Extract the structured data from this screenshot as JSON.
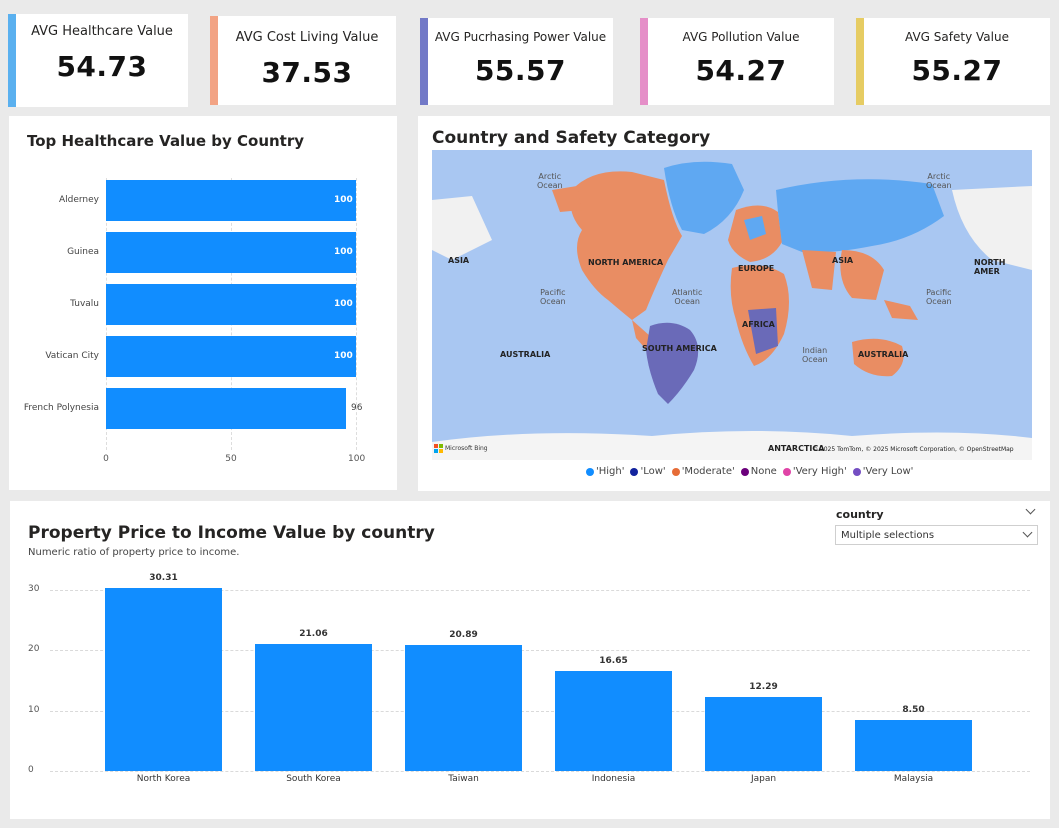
{
  "kpis": [
    {
      "label": "AVG Healthcare Value",
      "value": "54.73",
      "color": "#5ab0ef"
    },
    {
      "label": "AVG Cost Living Value",
      "value": "37.53",
      "color": "#f2a384"
    },
    {
      "label": "AVG Pucrhasing Power Value",
      "value": "55.57",
      "color": "#7279c7"
    },
    {
      "label": "AVG Pollution Value",
      "value": "54.27",
      "color": "#e58fc8"
    },
    {
      "label": "AVG Safety Value",
      "value": "55.27",
      "color": "#e6cc63"
    }
  ],
  "healthcare_chart": {
    "title": "Top Healthcare Value by Country",
    "chart_data": {
      "type": "bar",
      "orientation": "horizontal",
      "categories": [
        "Alderney",
        "Guinea",
        "Tuvalu",
        "Vatican City",
        "French Polynesia"
      ],
      "values": [
        100,
        100,
        100,
        100,
        96
      ],
      "value_labels": [
        "100",
        "100",
        "100",
        "100",
        "96"
      ],
      "xlim": [
        0,
        100
      ],
      "ticks": [
        "0",
        "50",
        "100"
      ],
      "color": "#118dff"
    }
  },
  "map": {
    "title": "Country and Safety Category",
    "oceans": [
      {
        "name": "Arctic\nOcean"
      },
      {
        "name": "Arctic\nOcean"
      },
      {
        "name": "Atlantic\nOcean"
      },
      {
        "name": "Pacific\nOcean"
      },
      {
        "name": "Pacific\nOcean"
      },
      {
        "name": "Indian\nOcean"
      }
    ],
    "continents": [
      "ASIA",
      "NORTH AMERICA",
      "EUROPE",
      "ASIA",
      "NORTH AMER",
      "AFRICA",
      "SOUTH AMERICA",
      "AUSTRALIA",
      "AUSTRALIA",
      "ANTARCTICA"
    ],
    "attribution": "© 2025 TomTom, © 2025 Microsoft Corporation, © OpenStreetMap",
    "bing_logo": "Microsoft Bing",
    "legend": [
      {
        "label": "'High'",
        "color": "#118dff"
      },
      {
        "label": "'Low'",
        "color": "#12239e"
      },
      {
        "label": "'Moderate'",
        "color": "#e66c37"
      },
      {
        "label": "None",
        "color": "#6b007b"
      },
      {
        "label": "'Very High'",
        "color": "#e044a7"
      },
      {
        "label": "'Very Low'",
        "color": "#744ec2"
      }
    ]
  },
  "property_chart": {
    "title": "Property Price to Income Value by country",
    "subtitle": "Numeric ratio of property price to income.",
    "slicer": {
      "title": "country",
      "value": "Multiple selections"
    },
    "chart_data": {
      "type": "bar",
      "categories": [
        "North Korea",
        "South Korea",
        "Taiwan",
        "Indonesia",
        "Japan",
        "Malaysia"
      ],
      "values": [
        30.31,
        21.06,
        20.89,
        16.65,
        12.29,
        8.5
      ],
      "value_labels": [
        "30.31",
        "21.06",
        "20.89",
        "16.65",
        "12.29",
        "8.50"
      ],
      "ylim": [
        0,
        30
      ],
      "yticks": [
        "0",
        "10",
        "20",
        "30"
      ],
      "color": "#118dff"
    }
  }
}
